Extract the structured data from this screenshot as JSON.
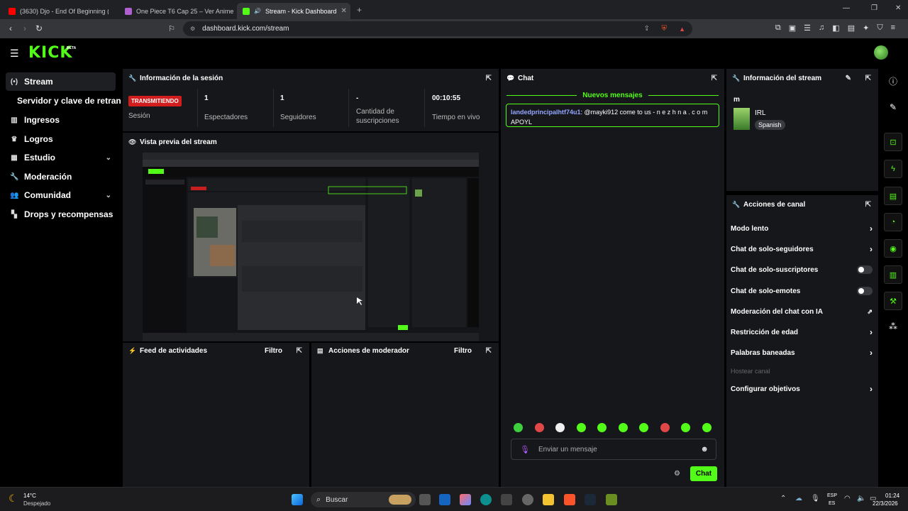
{
  "browser": {
    "tabs": [
      {
        "title": "(3630) Djo - End Of Beginning (Offici",
        "favicon_color": "#ff0000"
      },
      {
        "title": "One Piece T6 Cap 25 – Ver Anime",
        "favicon_color": "#b05fd0"
      },
      {
        "title": "Stream - Kick Dashboard",
        "favicon_color": "#53fc18"
      }
    ],
    "url": "dashboard.kick.com/stream"
  },
  "header": {
    "logo": "KICK",
    "beta": "BETA"
  },
  "sidebar": {
    "items": [
      {
        "label": "Stream",
        "icon": "broadcast-icon"
      },
      {
        "label": "Servidor y clave de retransm"
      },
      {
        "label": "Ingresos",
        "icon": "chart-icon"
      },
      {
        "label": "Logros",
        "icon": "trophy-icon"
      },
      {
        "label": "Estudio",
        "icon": "layout-icon"
      },
      {
        "label": "Moderación",
        "icon": "wrench-icon"
      },
      {
        "label": "Comunidad",
        "icon": "people-icon"
      },
      {
        "label": "Drops y recompensas",
        "icon": "gift-icon"
      }
    ]
  },
  "session": {
    "title": "Información de la sesión",
    "status_badge": "TRANSMITIENDO",
    "session_label": "Sesión",
    "viewers_value": "1",
    "viewers_label": "Espectadores",
    "followers_value": "1",
    "followers_label": "Seguidores",
    "subs_value": "-",
    "subs_label": "Cantidad de suscripciones",
    "live_value": "00:10:55",
    "live_label": "Tiempo en vivo"
  },
  "preview": {
    "title": "Vista previa del stream"
  },
  "activity_feed": {
    "title": "Feed de actividades",
    "filter": "Filtro"
  },
  "mod_actions": {
    "title": "Acciones de moderador",
    "filter": "Filtro"
  },
  "chat": {
    "title": "Chat",
    "new_messages": "Nuevos mensajes",
    "message": {
      "user": "landedprincipalhtf74u1",
      "text": ": @mayki912 come to us - n e z h n a . c o m APOYL"
    },
    "input_placeholder": "Enviar un mensaje",
    "send_label": "Chat",
    "emote_colors": [
      "#3ecf3e",
      "#e04848",
      "#f0f0f0",
      "#53fc18",
      "#53fc18",
      "#53fc18",
      "#53fc18",
      "#e04848",
      "#53fc18",
      "#53fc18"
    ]
  },
  "stream_info": {
    "title": "Información del stream",
    "stream_title": "m",
    "category": "IRL",
    "language": "Spanish"
  },
  "channel_actions": {
    "title": "Acciones de canal",
    "items": [
      {
        "label": "Modo lento",
        "type": "chevron"
      },
      {
        "label": "Chat de solo-seguidores",
        "type": "chevron"
      },
      {
        "label": "Chat de solo-suscriptores",
        "type": "toggle"
      },
      {
        "label": "Chat de solo-emotes",
        "type": "toggle"
      },
      {
        "label": "Moderación del chat con IA",
        "type": "external"
      },
      {
        "label": "Restricción de edad",
        "type": "chevron"
      },
      {
        "label": "Palabras baneadas",
        "type": "chevron"
      },
      {
        "label": "Hostear canal",
        "type": "disabled"
      },
      {
        "label": "Configurar objetivos",
        "type": "chevron"
      }
    ]
  },
  "taskbar": {
    "weather_temp": "14°C",
    "weather_desc": "Despejado",
    "search_placeholder": "Buscar",
    "lang_top": "ESP",
    "lang_bottom": "ES",
    "time": "01:24",
    "date": "22/3/2026"
  }
}
